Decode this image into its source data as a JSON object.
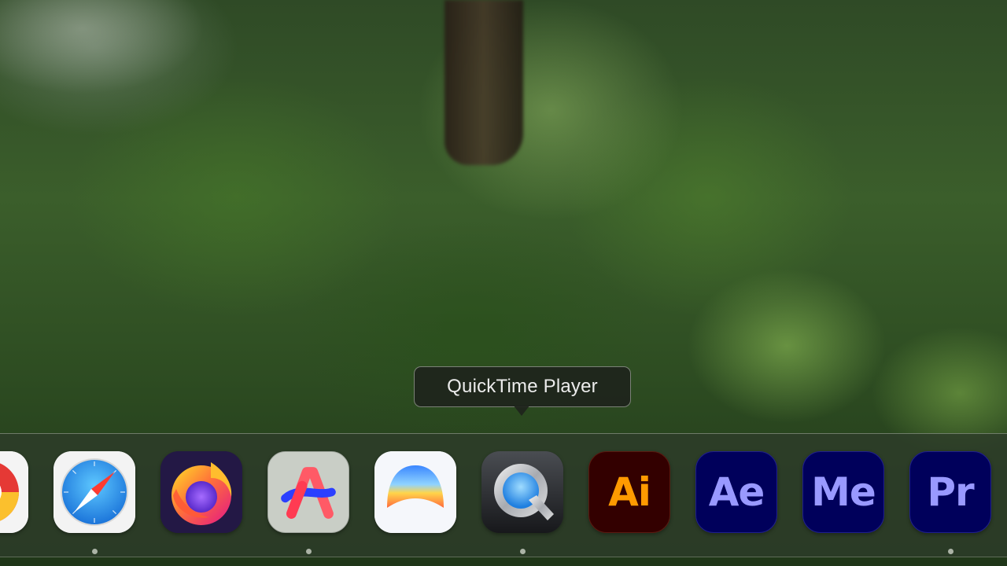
{
  "tooltip": {
    "text": "QuickTime Player"
  },
  "dock": {
    "items": [
      {
        "name": "Google Chrome",
        "icon": "chrome-icon",
        "running": false
      },
      {
        "name": "Safari",
        "icon": "safari-icon",
        "running": true
      },
      {
        "name": "Firefox",
        "icon": "firefox-icon",
        "running": false
      },
      {
        "name": "Arc",
        "icon": "arc-icon",
        "running": true
      },
      {
        "name": "Sunrise app",
        "icon": "sunrise-icon",
        "running": false
      },
      {
        "name": "QuickTime Player",
        "icon": "quicktime-icon",
        "running": true,
        "hovered": true
      },
      {
        "name": "Adobe Illustrator",
        "icon": "illustrator-icon",
        "label": "Ai",
        "running": false
      },
      {
        "name": "Adobe After Effects",
        "icon": "after-effects-icon",
        "label": "Ae",
        "running": false
      },
      {
        "name": "Adobe Media Encoder",
        "icon": "media-encoder-icon",
        "label": "Me",
        "running": false
      },
      {
        "name": "Adobe Premiere Pro",
        "icon": "premiere-pro-icon",
        "label": "Pr",
        "running": true
      }
    ]
  },
  "colors": {
    "illustrator_bg": "#330000",
    "illustrator_text": "#ff9a00",
    "adobe_video_bg": "#00005b",
    "after_effects_text": "#9999ff",
    "media_encoder_text": "#9999ff",
    "premiere_text": "#9999ff"
  }
}
